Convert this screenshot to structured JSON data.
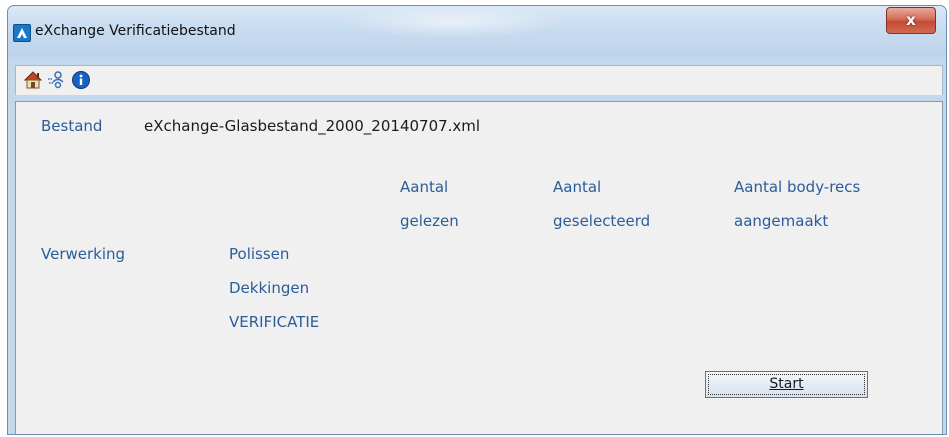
{
  "window": {
    "title": "eXchange Verificatiebestand",
    "close_symbol": "x"
  },
  "toolbar": {
    "icons": [
      "home-icon",
      "settings-people-icon",
      "info-icon"
    ],
    "colors": {
      "info": "#1b62c0",
      "home_roof": "#b84a2a",
      "people": "#3a6fb8"
    }
  },
  "file": {
    "label": "Bestand",
    "value": "eXchange-Glasbestand_2000_20140707.xml"
  },
  "columns": {
    "read": [
      "Aantal",
      "gelezen"
    ],
    "selected": [
      "Aantal",
      "geselecteerd"
    ],
    "created": [
      "Aantal body-recs",
      "aangemaakt"
    ]
  },
  "processing": {
    "label": "Verwerking",
    "items": [
      "Polissen",
      "Dekkingen",
      "VERIFICATIE"
    ]
  },
  "start_button": {
    "label": "Start"
  },
  "colors": {
    "label_blue": "#2a5d9a",
    "panel_bg": "#f0f0f0",
    "frame": "#c4d8ec",
    "close_red": "#c44a33"
  }
}
